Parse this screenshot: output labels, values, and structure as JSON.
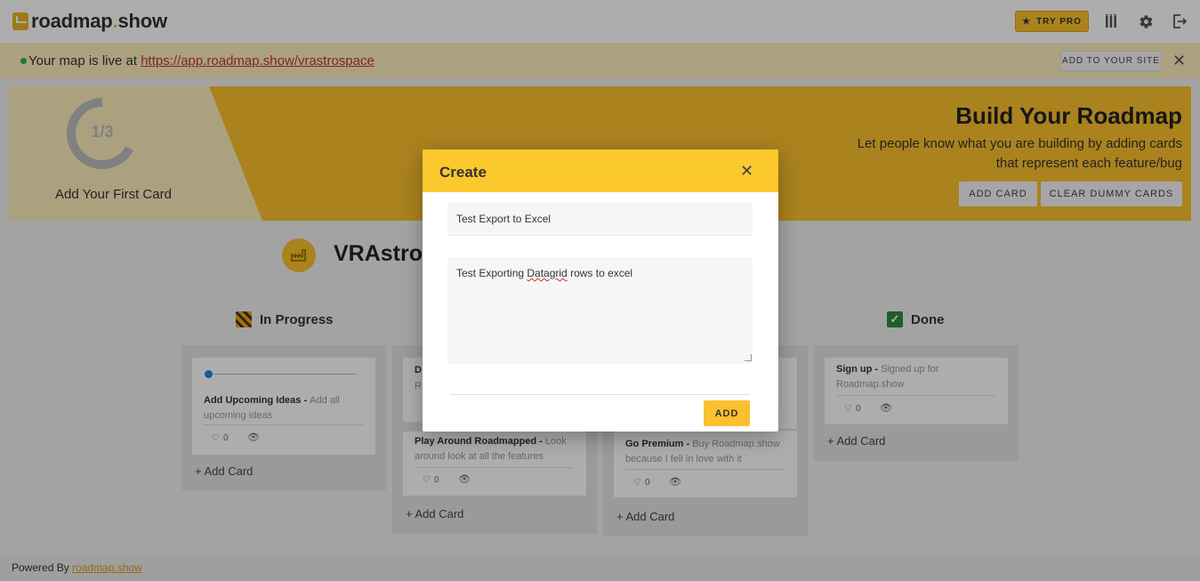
{
  "header": {
    "logo_main": "roadmap",
    "logo_dot": ".",
    "logo_suffix": "show",
    "try_pro_label": "TRY PRO",
    "icons": [
      "board-icon",
      "gear-icon",
      "logout-icon"
    ]
  },
  "banner": {
    "prefix": "Your map is live at ",
    "link": "https://app.roadmap.show/vrastrospace",
    "add_site_label": "ADD TO YOUR SITE"
  },
  "onboarding": {
    "progress_text": "1/3",
    "progress_fraction": 0.333,
    "step_label": "Add Your First Card",
    "title": "Build Your Roadmap",
    "subtitle": "Let people know what you are building by adding cards that represent each feature/bug",
    "add_card_label": "ADD CARD",
    "clear_dummy_label": "CLEAR DUMMY CARDS"
  },
  "board": {
    "title": "VRAstro's"
  },
  "columns": [
    {
      "title": "In Progress",
      "cards": [
        {
          "title": "Add Upcoming Ideas - ",
          "desc": "Add all upcoming ideas",
          "likes": "0"
        }
      ],
      "add_label": "+ Add Card"
    },
    {
      "title": "",
      "cards": [
        {
          "title": "D",
          "desc": "R",
          "likes": ""
        },
        {
          "title": "Play Around Roadmapped - ",
          "desc": "Look around look at all the features",
          "likes": "0"
        }
      ],
      "add_label": "+ Add Card"
    },
    {
      "title": "",
      "cards": [
        {
          "title": "Go Premium - ",
          "desc": "Buy Roadmap.show because I fell in love with it",
          "likes": "0"
        }
      ],
      "add_label": "+ Add Card"
    },
    {
      "title": "Done",
      "cards": [
        {
          "title": "Sign up - ",
          "desc": "Signed up for Roadmap.show",
          "likes": "0"
        }
      ],
      "add_label": "+ Add Card"
    }
  ],
  "footer": {
    "prefix": "Powered By ",
    "link": "roadmap.show"
  },
  "modal": {
    "title": "Create",
    "title_value": "Test Export to Excel",
    "desc_before": "Test Exporting ",
    "desc_spell": "Datagrid",
    "desc_after": " rows to excel",
    "add_label": "ADD"
  },
  "colors": {
    "accent": "#fbc02d",
    "banner": "#fdeebb",
    "live_dot": "#27ae60"
  }
}
